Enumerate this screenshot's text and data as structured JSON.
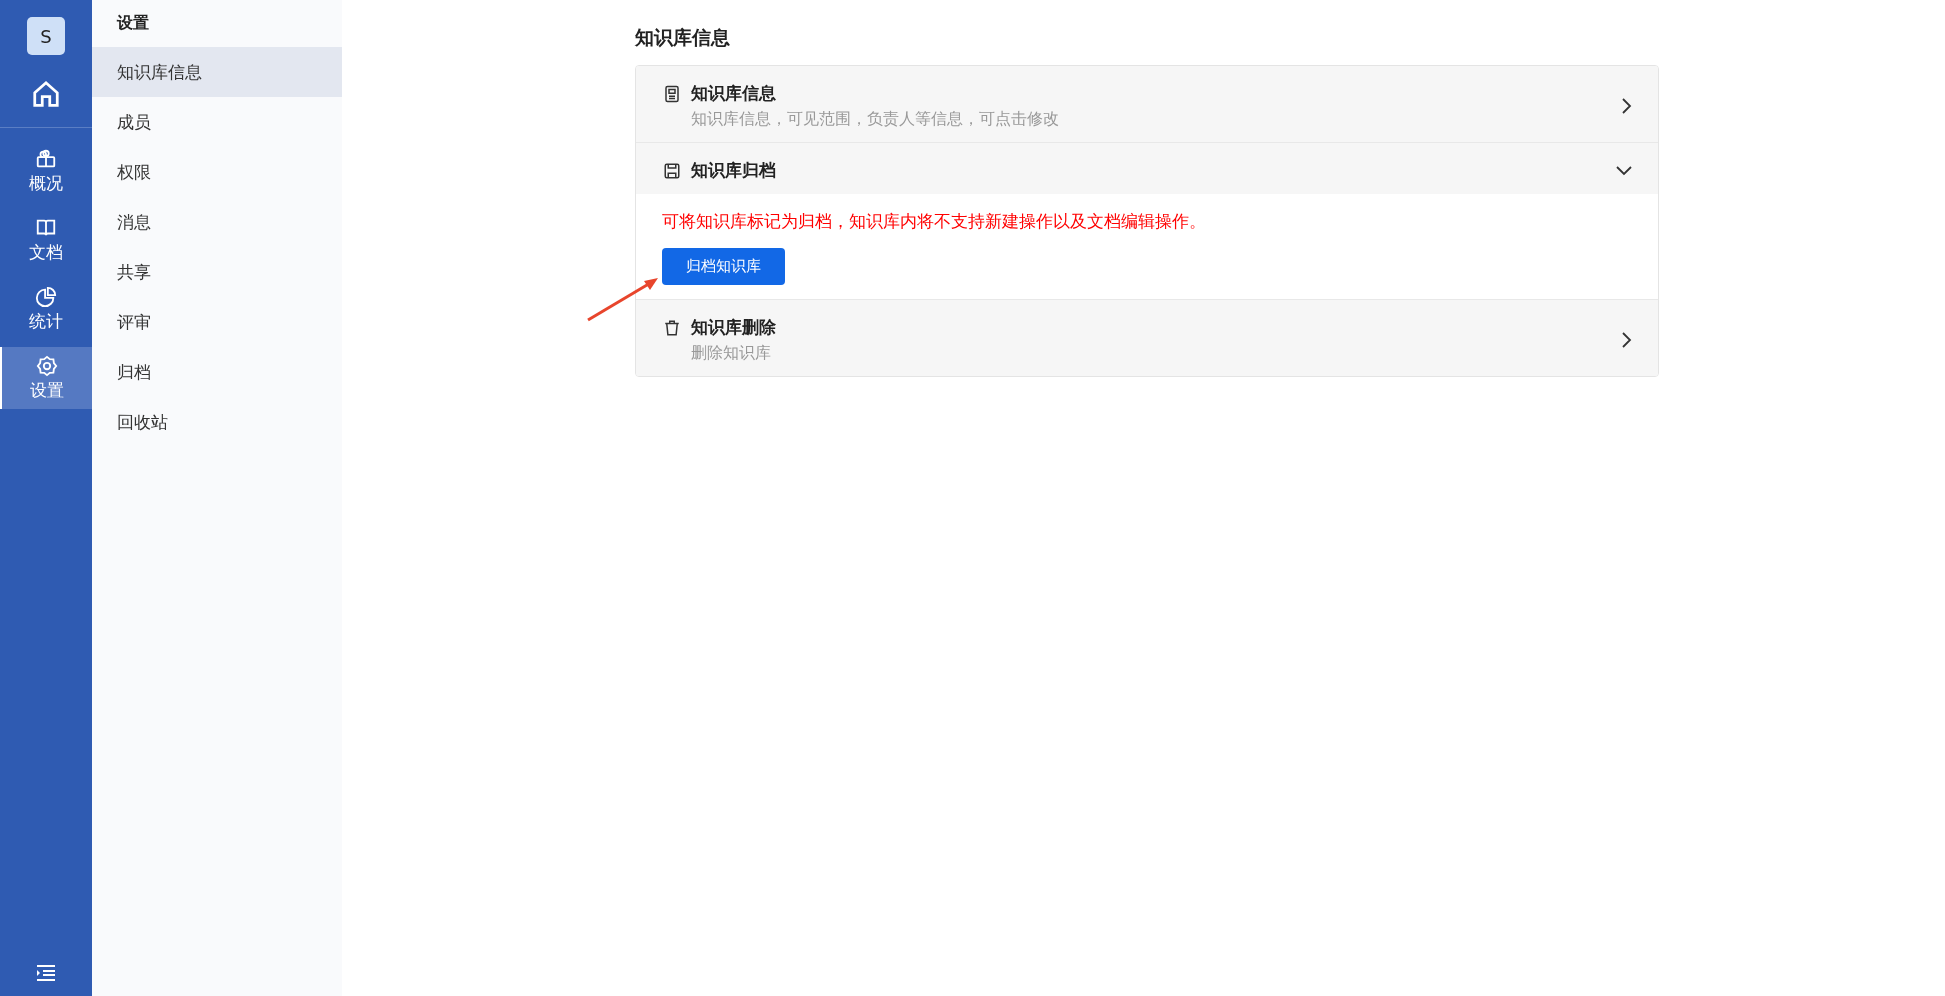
{
  "rail": {
    "avatar": "S",
    "items": [
      {
        "label": "概况",
        "selected": false
      },
      {
        "label": "文档",
        "selected": false
      },
      {
        "label": "统计",
        "selected": false
      },
      {
        "label": "设置",
        "selected": true
      }
    ]
  },
  "sidebar": {
    "title": "设置",
    "items": [
      {
        "label": "知识库信息",
        "selected": true
      },
      {
        "label": "成员",
        "selected": false
      },
      {
        "label": "权限",
        "selected": false
      },
      {
        "label": "消息",
        "selected": false
      },
      {
        "label": "共享",
        "selected": false
      },
      {
        "label": "评审",
        "selected": false
      },
      {
        "label": "归档",
        "selected": false
      },
      {
        "label": "回收站",
        "selected": false
      }
    ]
  },
  "page_title": "知识库信息",
  "sections": [
    {
      "title": "知识库信息",
      "subtitle": "知识库信息，可见范围，负责人等信息，可点击修改",
      "expanded": false
    },
    {
      "title": "知识库归档",
      "expanded": true,
      "warning": "可将知识库标记为归档，知识库内将不支持新建操作以及文档编辑操作。",
      "button": "归档知识库"
    },
    {
      "title": "知识库删除",
      "subtitle": "删除知识库",
      "expanded": false
    }
  ]
}
